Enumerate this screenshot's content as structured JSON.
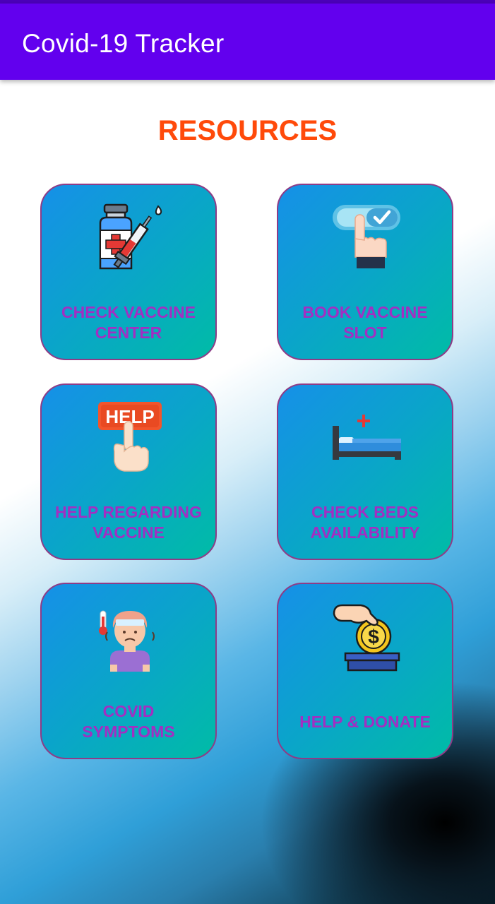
{
  "app": {
    "title": "Covid-19 Tracker"
  },
  "main": {
    "heading": "RESOURCES",
    "cards": [
      {
        "label": "CHECK VACCINE\nCENTER",
        "icon": "vaccine-bottle-syringe-icon"
      },
      {
        "label": "BOOK VACCINE\nSLOT",
        "icon": "finger-tap-toggle-icon"
      },
      {
        "label": "HELP REGARDING\nVACCINE",
        "icon": "help-sign-hand-icon"
      },
      {
        "label": "CHECK BEDS\nAVAILABILITY",
        "icon": "hospital-bed-icon"
      },
      {
        "label": "COVID\nSYMPTOMS",
        "icon": "sick-person-thermometer-icon"
      },
      {
        "label": "HELP & DONATE",
        "icon": "hand-coin-donation-icon"
      }
    ]
  },
  "colors": {
    "appbar": "#6200ee",
    "heading": "#ff4a0a",
    "card_label": "#a22fc2",
    "card_border": "#8e3c87"
  }
}
